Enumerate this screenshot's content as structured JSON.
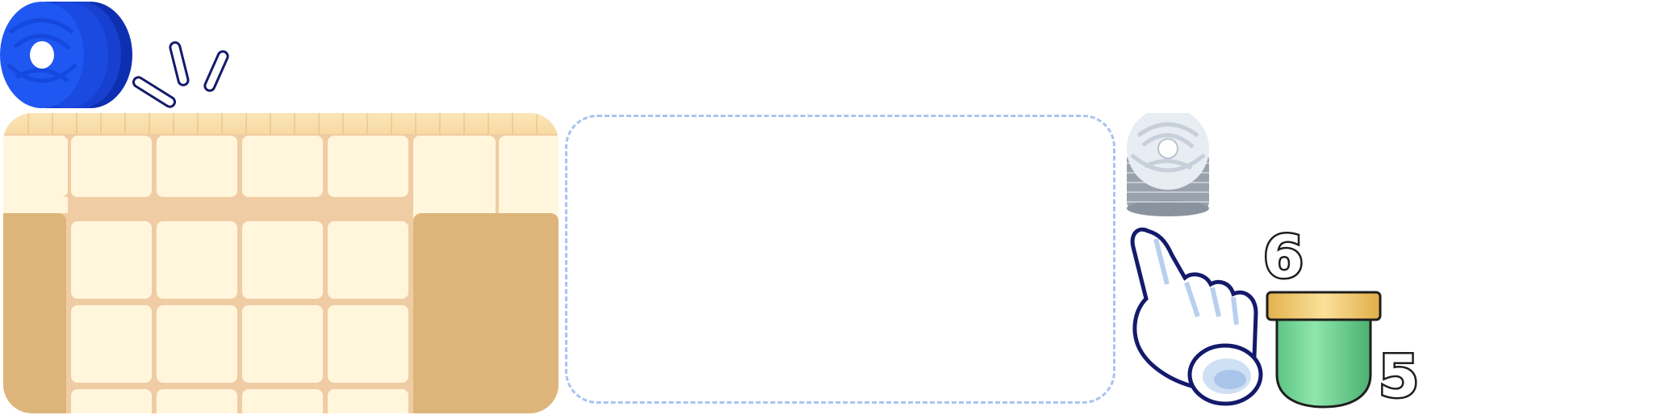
{
  "game": {
    "held_piece": {
      "color": "#1f57f2",
      "icon": "blue-yarn-spool"
    },
    "next_piece": {
      "color": "#e8edf3",
      "icon": "white-yarn-spool"
    },
    "hint_icon": "pointing-hand-icon",
    "counters": {
      "top": "6",
      "bottom": "5"
    },
    "pot": {
      "body_color": "#7fdca0",
      "rim_color": "#f2c86a"
    },
    "board": {
      "tile_color": "#fff6dc",
      "wall_color": "#ddb57b",
      "grout_color": "#f0cca4"
    },
    "drop_zone": {
      "border_color": "#a8c4ee"
    }
  }
}
